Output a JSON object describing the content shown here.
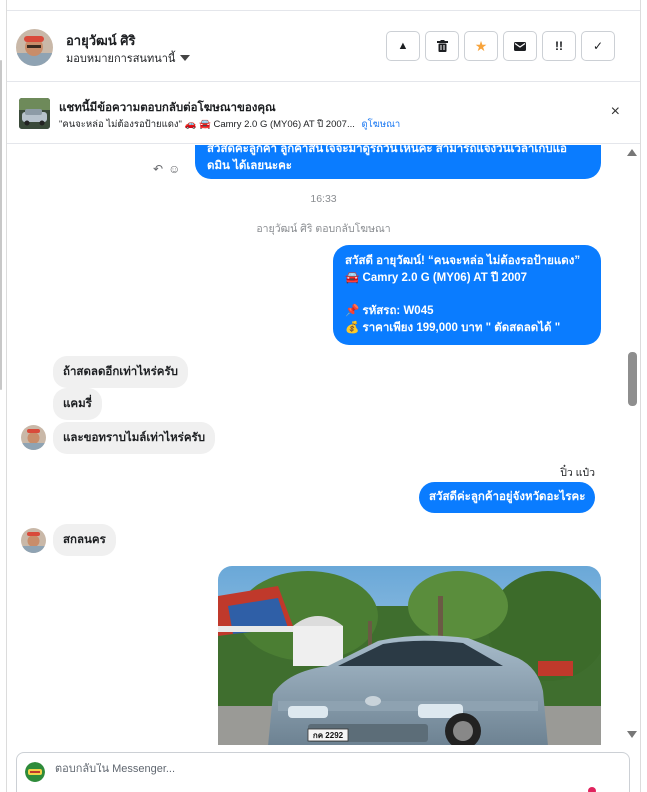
{
  "header": {
    "contact_name": "อายุวัฒน์ ศิริ",
    "assign_label": "มอบหมายการสนทนานี้",
    "actions": [
      {
        "icon": "warning-icon",
        "glyph": "▲"
      },
      {
        "icon": "trash-icon",
        "glyph": "🗑"
      },
      {
        "icon": "star-icon",
        "glyph": "★"
      },
      {
        "icon": "mail-icon",
        "glyph": "✉"
      },
      {
        "icon": "follow-up-icon",
        "glyph": "!!"
      },
      {
        "icon": "check-icon",
        "glyph": "✓"
      }
    ]
  },
  "banner": {
    "title": "แชทนี้มีข้อความตอบกลับต่อโฆษณาของคุณ",
    "subtitle": "\"คนจะหล่อ ไม่ต้องรอป้ายแดง\" 🚗 🚘 Camry 2.0 G (MY06) AT ปี 2007...",
    "link": "ดูโฆษณา",
    "close": "×"
  },
  "messages": {
    "first_line1": "สวัสดีค่ะลูกค้า ลูกค้าสนใจจะมาดูรถวันไหนคะ สามารถแจ้งวันเวลาเก็บแอ",
    "first_line2": "ดมิน ได้เลยนะคะ",
    "timestamp": "16:33",
    "ad_reply_note": "อายุวัฒน์ ศิริ ตอบกลับโฆษณา",
    "ad_msg": {
      "line1": "สวัสดี อายุวัฒน์! “คนจะหล่อ ไม่ต้องรอป้ายแดง”",
      "line2": "🚘 Camry 2.0 G (MY06) AT ปี 2007",
      "line3": "📌 รหัสรถ: W045",
      "line4": "💰 ราคาเพียง 199,000 บาท \" ตัดสดลดได้ \""
    },
    "in1": "ถ้าสดลดอีกเท่าไหร่ครับ",
    "in2": "แคมรี่",
    "in3": "และขอทราบไมล์เท่าไหร่ครับ",
    "sender_name": "ปิ๋ว แป๋ว",
    "out2": "สวัสดีค่ะลูกค้าอยู่จังหวัดอะไรคะ",
    "in4": "สกลนคร",
    "plate": "กค 2292"
  },
  "composer": {
    "placeholder": "ตอบกลับใน Messenger..."
  },
  "colors": {
    "outgoing_bubble": "#0a7cff",
    "incoming_bubble": "#f0f0f0",
    "link": "#1877f2",
    "star": "#f7a33b"
  }
}
